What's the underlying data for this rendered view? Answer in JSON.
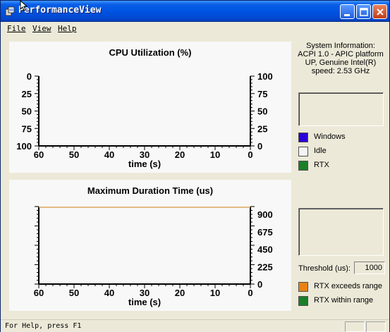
{
  "window": {
    "title": "PerformanceView"
  },
  "menu": {
    "file": "File",
    "view": "View",
    "help": "Help"
  },
  "cpu_chart": {
    "title": "CPU Utilization (%)",
    "xlabel": "time (s)",
    "x_ticks": [
      "60",
      "50",
      "40",
      "30",
      "20",
      "10",
      "0"
    ],
    "left_ticks": [
      "0",
      "25",
      "50",
      "75",
      "100"
    ],
    "right_ticks": [
      "100",
      "75",
      "50",
      "25",
      "0"
    ]
  },
  "duration_chart": {
    "title": "Maximum Duration Time (us)",
    "xlabel": "time (s)",
    "x_ticks": [
      "60",
      "50",
      "40",
      "30",
      "20",
      "10",
      "0"
    ],
    "right_ticks": [
      "900",
      "675",
      "450",
      "225",
      "0"
    ],
    "threshold_color": "#d9a55c"
  },
  "system_info": {
    "heading": "System Information:",
    "line1": "ACPI 1.0 - APIC platform",
    "line2": "UP, Genuine Intel(R)",
    "line3": "speed: 2.53 GHz"
  },
  "legend_cpu": [
    {
      "label": "Windows",
      "color": "#2b00d6"
    },
    {
      "label": "Idle",
      "color": "#f4f4f4"
    },
    {
      "label": "RTX",
      "color": "#1a7f28"
    }
  ],
  "threshold": {
    "label": "Threshold (us):",
    "value": "1000"
  },
  "legend_duration": [
    {
      "label": "RTX exceeds range",
      "color": "#e98315"
    },
    {
      "label": "RTX within range",
      "color": "#1a7f28"
    }
  ],
  "status": {
    "text": "For Help, press F1"
  }
}
